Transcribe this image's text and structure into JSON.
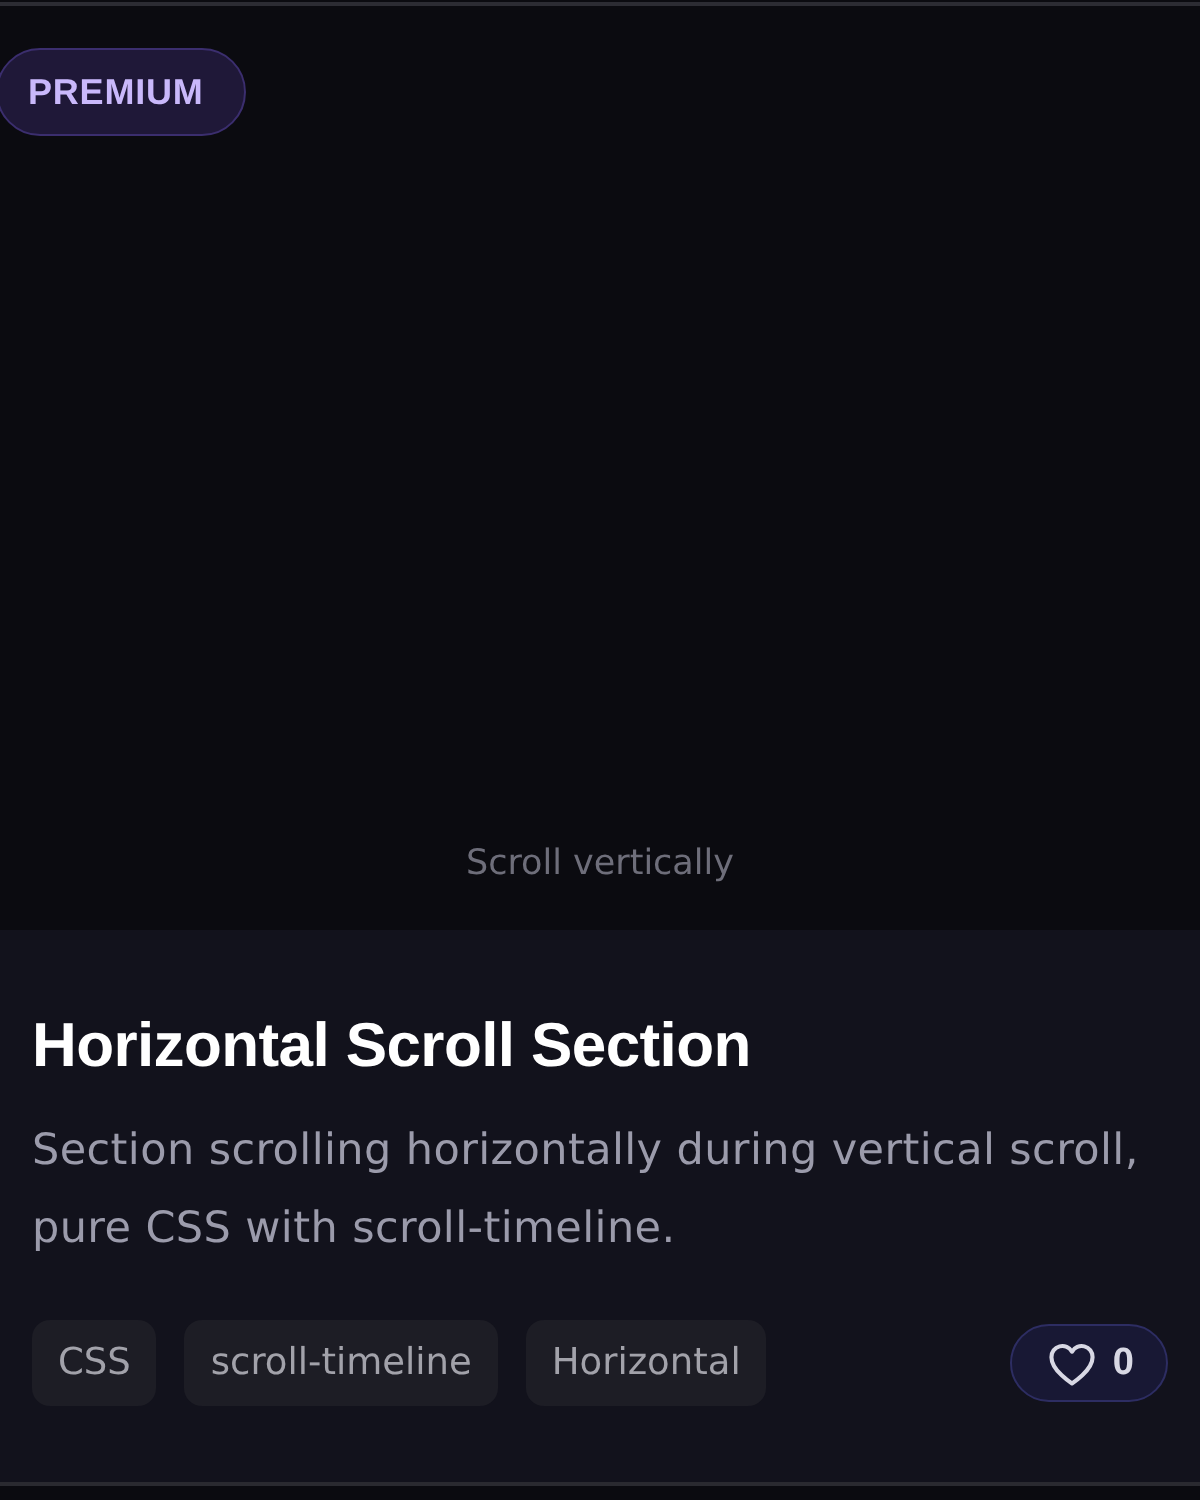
{
  "card": {
    "badge": "PREMIUM",
    "preview": {
      "hint": "Scroll vertically"
    },
    "title": "Horizontal Scroll Section",
    "description": "Section scrolling horizontally during vertical scroll, pure CSS with scroll-timeline.",
    "tags": [
      "CSS",
      "scroll-timeline",
      "Horizontal"
    ],
    "likes": {
      "count": "0"
    }
  }
}
